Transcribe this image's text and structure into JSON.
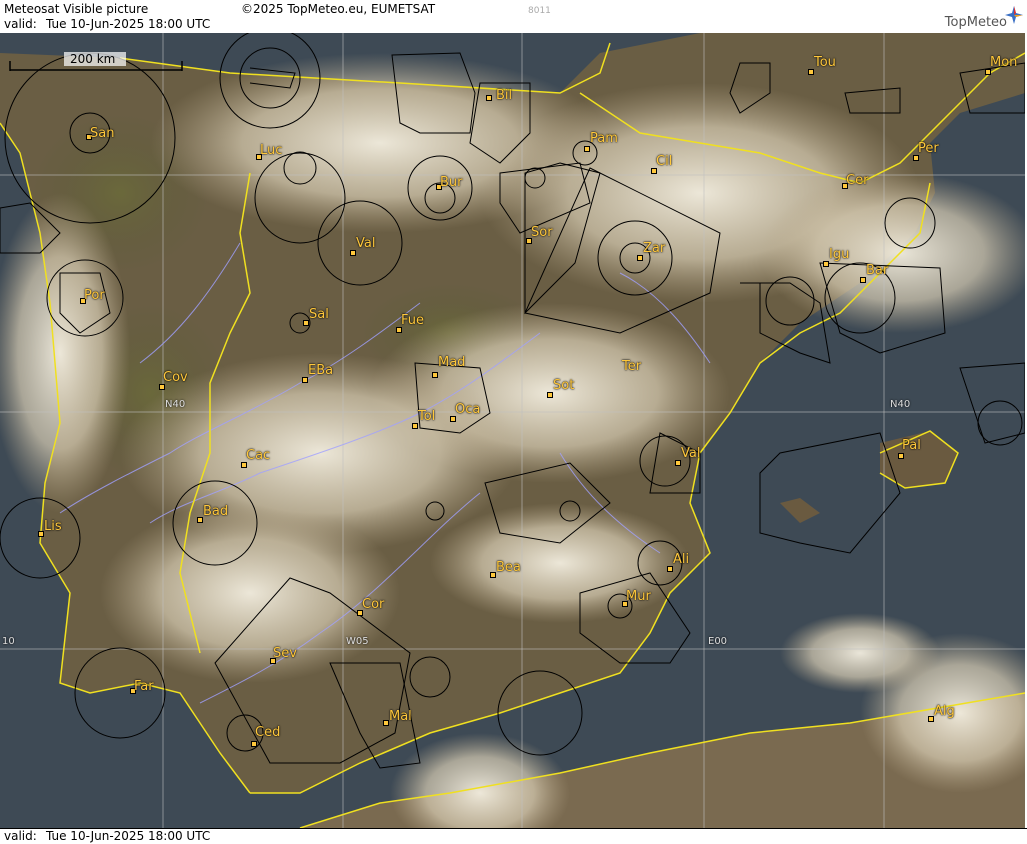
{
  "header": {
    "title": "Meteosat Visible picture",
    "copyright": "©2025 TopMeteo.eu, EUMETSAT",
    "code": "8011",
    "valid_label": "valid:",
    "valid_value": "Tue 10-Jun-2025 18:00 UTC",
    "logo_text": "TopMeteo"
  },
  "scale": {
    "label": "200 km"
  },
  "grid_labels": {
    "lat40_left": "N40",
    "lat40_right": "N40",
    "lon0": "E00",
    "lon5w": "W05",
    "lon10w": "10"
  },
  "footer": {
    "valid_label": "valid:",
    "valid_value": "Tue 10-Jun-2025 18:00 UTC"
  },
  "cities": [
    {
      "id": "san",
      "label": "San"
    },
    {
      "id": "luc",
      "label": "Luc"
    },
    {
      "id": "bil",
      "label": "Bil"
    },
    {
      "id": "pam",
      "label": "Pam"
    },
    {
      "id": "cil",
      "label": "Cil"
    },
    {
      "id": "tou",
      "label": "Tou"
    },
    {
      "id": "mon",
      "label": "Mon"
    },
    {
      "id": "per",
      "label": "Per"
    },
    {
      "id": "cer",
      "label": "Cer"
    },
    {
      "id": "bur",
      "label": "Bur"
    },
    {
      "id": "sor",
      "label": "Sor"
    },
    {
      "id": "zar",
      "label": "Zar"
    },
    {
      "id": "igu",
      "label": "Igu"
    },
    {
      "id": "bar",
      "label": "Bar"
    },
    {
      "id": "val1",
      "label": "Val"
    },
    {
      "id": "por",
      "label": "Por"
    },
    {
      "id": "sal",
      "label": "Sal"
    },
    {
      "id": "fue",
      "label": "Fue"
    },
    {
      "id": "mad",
      "label": "Mad"
    },
    {
      "id": "cov",
      "label": "Cov"
    },
    {
      "id": "eba",
      "label": "EBa"
    },
    {
      "id": "sot",
      "label": "Sot"
    },
    {
      "id": "ter",
      "label": "Ter"
    },
    {
      "id": "tol",
      "label": "Tol"
    },
    {
      "id": "oca",
      "label": "Oca"
    },
    {
      "id": "pal",
      "label": "Pal"
    },
    {
      "id": "cac",
      "label": "Cac"
    },
    {
      "id": "val2",
      "label": "Val"
    },
    {
      "id": "bad",
      "label": "Bad"
    },
    {
      "id": "lis",
      "label": "Lis"
    },
    {
      "id": "ali",
      "label": "Ali"
    },
    {
      "id": "bea",
      "label": "Bea"
    },
    {
      "id": "mur",
      "label": "Mur"
    },
    {
      "id": "cor",
      "label": "Cor"
    },
    {
      "id": "sev",
      "label": "Sev"
    },
    {
      "id": "far",
      "label": "Far"
    },
    {
      "id": "mal",
      "label": "Mal"
    },
    {
      "id": "alg",
      "label": "Alg"
    },
    {
      "id": "ced",
      "label": "Ced"
    }
  ],
  "colors": {
    "city": "#ffc83c",
    "coast": "#f0e020",
    "rivers": "#a0a0ff",
    "airspace": "#000000",
    "grid": "#c0c0c0"
  }
}
